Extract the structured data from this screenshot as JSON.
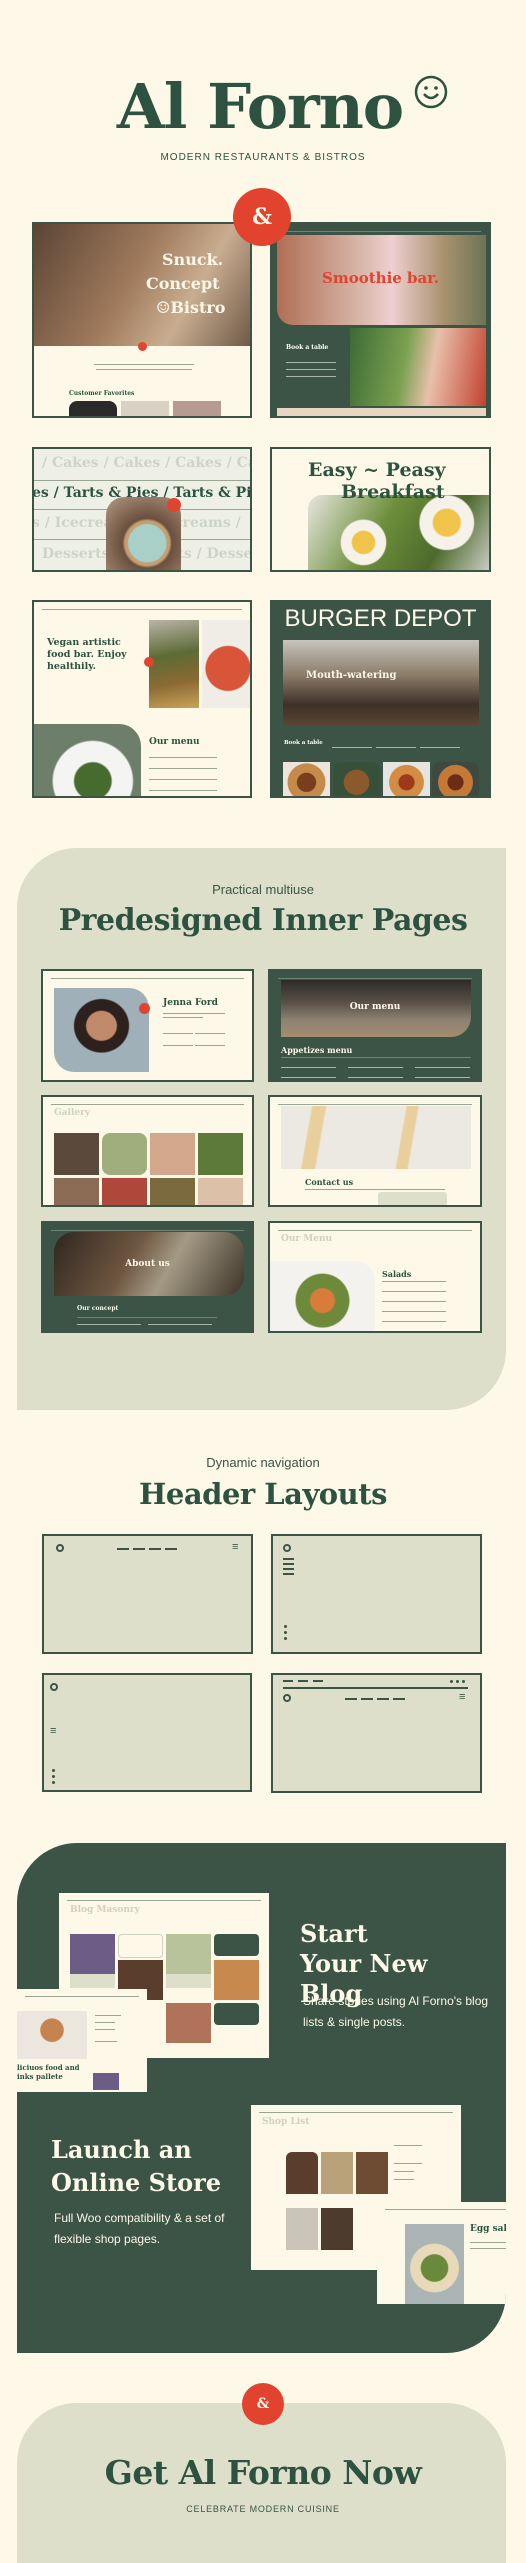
{
  "colors": {
    "background": "#fdf8e7",
    "brand_green": "#2d5340",
    "dark_panel": "#3b5446",
    "sage": "#dddfcb",
    "accent_red": "#e2432f"
  },
  "hero": {
    "logo": "Al Forno",
    "logo_icon": "smiley-icon",
    "tagline": "MODERN RESTAURANTS & BISTROS",
    "badge": "&"
  },
  "demos": {
    "bistro": {
      "line1": "Snuck.",
      "line2": "Concept",
      "line3": "Bistro",
      "section": "Customer Favorites"
    },
    "smoothie": {
      "title": "Smoothie bar.",
      "form_title": "Book a table"
    },
    "desserts": {
      "row1": "/ Cakes / Cakes / Cakes / Cakes",
      "row2": "es /  Tarts & Pies /  Tarts & Pies",
      "row3": "s / Icecreams / Icecreams /",
      "row4": "Desserts / Desserts / Desserts"
    },
    "breakfast": {
      "line1": "Easy ~ Peasy",
      "line2": "Breakfast"
    },
    "vegan": {
      "title": "Vegan artistic food bar. Enjoy healthily.",
      "menu_title": "Our menu"
    },
    "burger": {
      "brand": "BURGER DEPOT",
      "hero": "Mouth-watering",
      "form_title": "Book a table"
    }
  },
  "inner_pages": {
    "kicker": "Practical multiuse",
    "title": "Predesigned Inner Pages",
    "team": {
      "name": "Jenna Ford"
    },
    "menu_dark": {
      "hero": "Our menu",
      "section": "Appetizes menu"
    },
    "gallery": {
      "title": "Gallery"
    },
    "contact": {
      "title": "Contact us"
    },
    "about": {
      "hero": "About us",
      "section": "Our concept"
    },
    "menu_light": {
      "title": "Our Menu",
      "section": "Salads"
    }
  },
  "headers": {
    "kicker": "Dynamic navigation",
    "title": "Header Layouts"
  },
  "blog": {
    "title": "Start Your New Blog",
    "description": "Share stories using Al Forno's blog lists & single posts.",
    "masonry_title": "Blog Masonry",
    "single_title": "liciuos food and inks pallete"
  },
  "shop": {
    "title": "Launch an Online Store",
    "description": "Full Woo compatibility & a set of flexible shop pages.",
    "list_title": "Shop List",
    "product_title": "Egg salad"
  },
  "cta": {
    "badge": "&",
    "title": "Get Al Forno Now",
    "subtitle": "CELEBRATE MODERN CUISINE"
  }
}
